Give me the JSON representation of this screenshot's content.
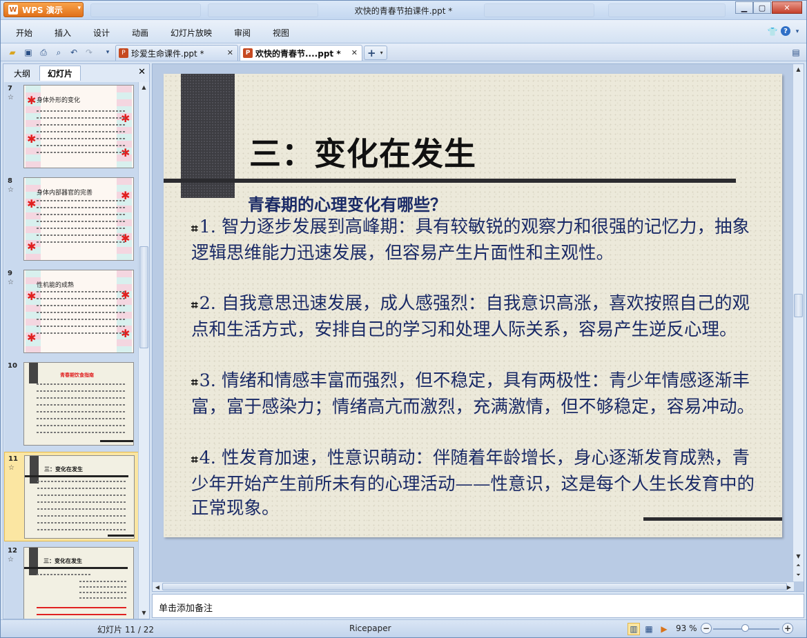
{
  "app": {
    "button_label": "WPS 演示",
    "window_title": "欢快的青春节拍课件.ppt *"
  },
  "menu": [
    "开始",
    "插入",
    "设计",
    "动画",
    "幻灯片放映",
    "审阅",
    "视图"
  ],
  "doc_tabs": [
    {
      "label": "珍爱生命课件.ppt *",
      "active": false
    },
    {
      "label": "欢快的青春节....ppt *",
      "active": true
    }
  ],
  "panel": {
    "tabs": [
      "大纲",
      "幻灯片"
    ],
    "active_tab": "幻灯片"
  },
  "thumbnails": [
    {
      "num": "7",
      "title": "身体外形的变化",
      "selected": false,
      "style": "floral"
    },
    {
      "num": "8",
      "title": "身体内部器官的完善",
      "selected": false,
      "style": "floral"
    },
    {
      "num": "9",
      "title": "性机能的成熟",
      "selected": false,
      "style": "floral"
    },
    {
      "num": "10",
      "title": "青春期饮食指南",
      "selected": false,
      "style": "rice"
    },
    {
      "num": "11",
      "title": "三：变化在发生",
      "selected": true,
      "style": "rice"
    },
    {
      "num": "12",
      "title": "三：变化在发生",
      "selected": false,
      "style": "rice"
    }
  ],
  "slide": {
    "title": "三：变化在发生",
    "subtitle": "青春期的心理变化有哪些？",
    "paragraphs": [
      "1. 智力逐步发展到高峰期：具有较敏锐的观察力和很强的记忆力，抽象逻辑思维能力迅速发展，但容易产生片面性和主观性。",
      "2. 自我意思迅速发展，成人感强烈：自我意识高涨，喜欢按照自己的观点和生活方式，安排自己的学习和处理人际关系，容易产生逆反心理。",
      "3. 情绪和情感丰富而强烈，但不稳定，具有两极性：青少年情感逐渐丰富，富于感染力；情绪高亢而激烈，充满激情，但不够稳定，容易冲动。",
      "4. 性发育加速，性意识萌动：伴随着年龄增长，身心逐渐发育成熟，青少年开始产生前所未有的心理活动——性意识，这是每个人生长发育中的正常现象。"
    ]
  },
  "notes": {
    "placeholder": "单击添加备注"
  },
  "status": {
    "slide_counter": "幻灯片 11 / 22",
    "template": "Ricepaper",
    "zoom": "93 %"
  }
}
